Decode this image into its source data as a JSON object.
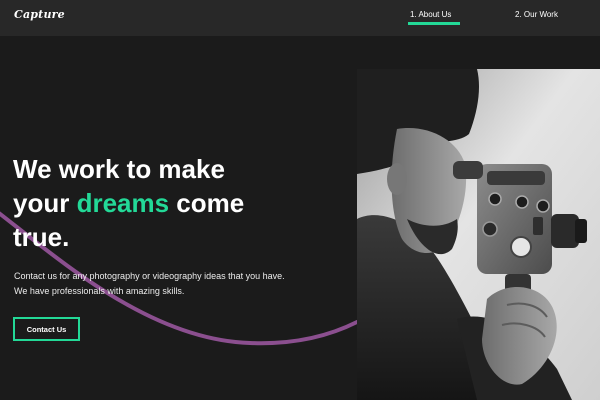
{
  "nav": {
    "logo": "Capture",
    "links": [
      {
        "label": "1. About Us",
        "active": true
      },
      {
        "label": "2. Our Work",
        "active": false
      }
    ]
  },
  "hero": {
    "headline_line1": "We work to make",
    "headline_prefix": "your ",
    "headline_accent": "dreams",
    "headline_suffix": " come",
    "headline_line3": "true.",
    "description_line1": "Contact us for any photography or videography ideas that you have.",
    "description_line2": "We have professionals with amazing skills.",
    "cta_label": "Contact Us"
  },
  "colors": {
    "accent": "#23d997",
    "background": "#1b1b1b",
    "navbar": "#282828",
    "curve": "#8b4f8f"
  },
  "icons": {
    "hero_image": "man-with-film-camera-photo"
  }
}
